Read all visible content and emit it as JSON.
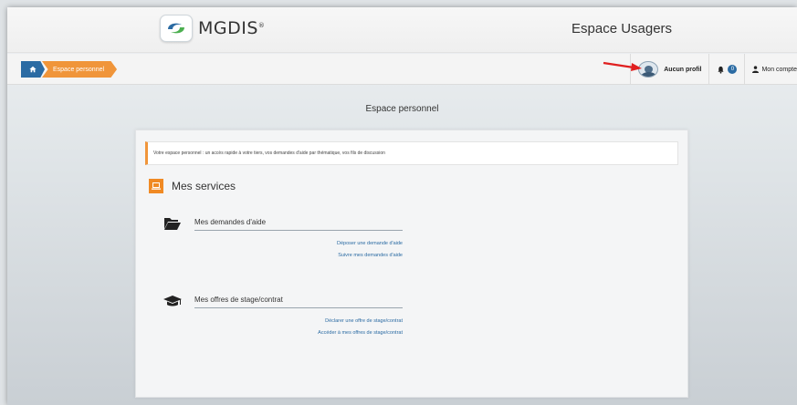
{
  "header": {
    "logo_text": "MGDIS",
    "logo_mark": "®",
    "site_title": "Espace Usagers"
  },
  "breadcrumb": {
    "home_icon": "home-icon",
    "current": "Espace personnel"
  },
  "nav": {
    "profile_label": "Aucun profil",
    "notifications_count": "0",
    "account_label": "Mon compte"
  },
  "page": {
    "title": "Espace personnel",
    "intro": "Votre espace personnel : un accès rapide à votre tiers, vos demandes d'aide par thématique, vos fils de discussion"
  },
  "services": {
    "title": "Mes services",
    "blocks": [
      {
        "title": "Mes demandes d'aide",
        "icon": "folder-open-icon",
        "links": [
          "Déposer une demande d'aide",
          "Suivre mes demandes d'aide"
        ]
      },
      {
        "title": "Mes offres de stage/contrat",
        "icon": "graduation-cap-icon",
        "links": [
          "Déclarer une offre de stage/contrat",
          "Accéder à mes offres de stage/contrat"
        ]
      }
    ]
  },
  "colors": {
    "accent_orange": "#f0953a",
    "primary_blue": "#2b6ba3",
    "annotation_red": "#e02020"
  }
}
